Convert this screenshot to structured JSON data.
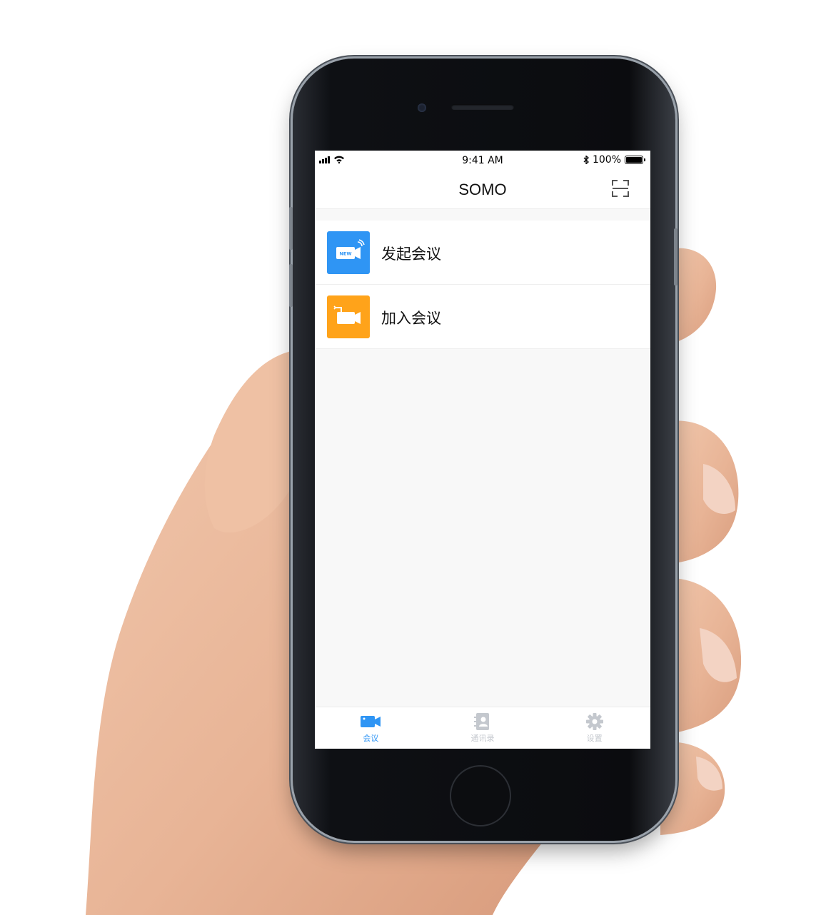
{
  "status_bar": {
    "time": "9:41 AM",
    "battery": "100%"
  },
  "header": {
    "title": "SOMO"
  },
  "menu": {
    "items": [
      {
        "label": "发起会议",
        "icon": "new-meeting-camera-icon",
        "color": "#2f95f4",
        "badge": "NEW"
      },
      {
        "label": "加入会议",
        "icon": "join-meeting-camera-icon",
        "color": "#ffa31a"
      }
    ]
  },
  "tabs": [
    {
      "label": "会议",
      "icon": "video-camera-icon",
      "active": true
    },
    {
      "label": "通讯录",
      "icon": "contacts-icon",
      "active": false
    },
    {
      "label": "设置",
      "icon": "gear-icon",
      "active": false
    }
  ],
  "colors": {
    "accent": "#2f95f4",
    "tab_inactive": "#c4c8ce",
    "join": "#ffa31a"
  }
}
